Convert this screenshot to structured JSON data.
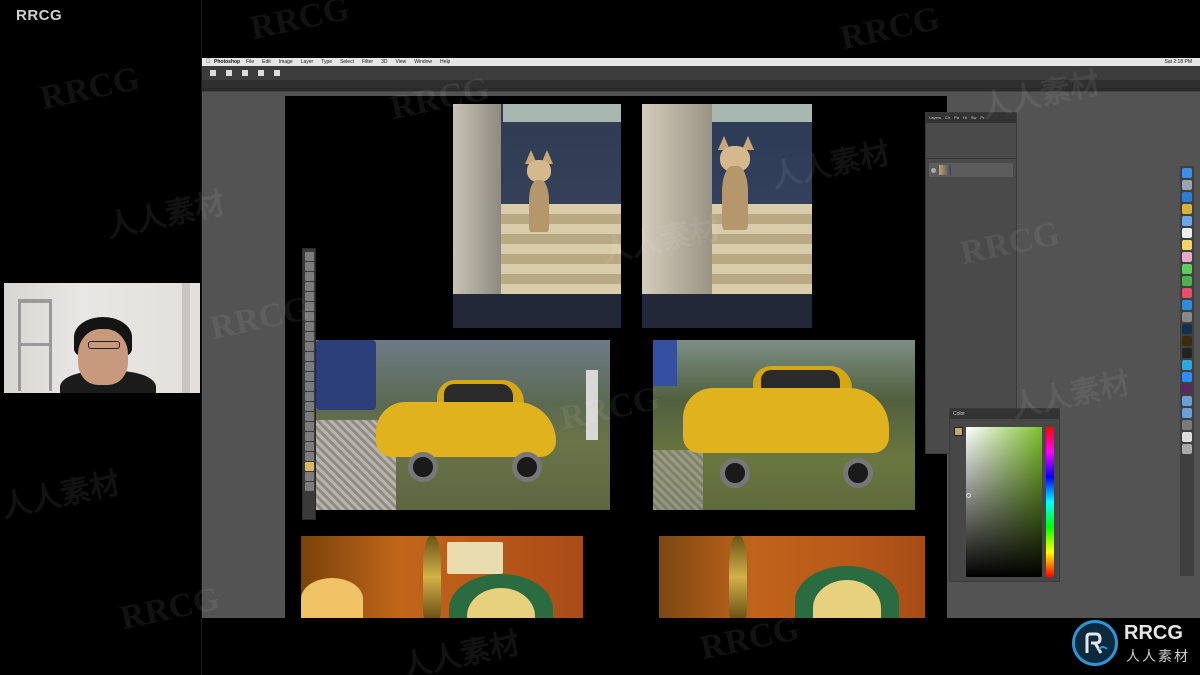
{
  "brand": {
    "corner_label": "RRCG"
  },
  "webcam": {
    "icon": "person-icon"
  },
  "photoshop": {
    "app_name": "Photoshop",
    "menu": [
      "File",
      "Edit",
      "Image",
      "Layer",
      "Type",
      "Select",
      "Filter",
      "3D",
      "View",
      "Window",
      "Help"
    ],
    "status_right": [
      "Sat 2:18 PM"
    ],
    "layers_panel": {
      "tabs": [
        "Layers",
        "Ch",
        "Pa",
        "Hi",
        "Sw",
        "Pr"
      ],
      "layer_rows": [
        ""
      ]
    },
    "color_panel": {
      "title": "Color"
    }
  },
  "logo": {
    "title": "RRCG",
    "subtitle": "人人素材"
  },
  "watermarks": [
    "RRCG",
    "人人素材",
    "RRCG",
    "RRCG",
    "人人素材",
    "RRCG",
    "人人素材",
    "RRCG",
    "人人素材",
    "RRCG",
    "人人素材",
    "RRCG",
    "RRCG",
    "人人素材",
    "RRCG",
    "人人素材"
  ],
  "colors": {
    "accent_blue": "#2e95d4",
    "ps_bg": "#535353",
    "canvas_bg": "#000000",
    "car_yellow": "#e0b21d"
  }
}
